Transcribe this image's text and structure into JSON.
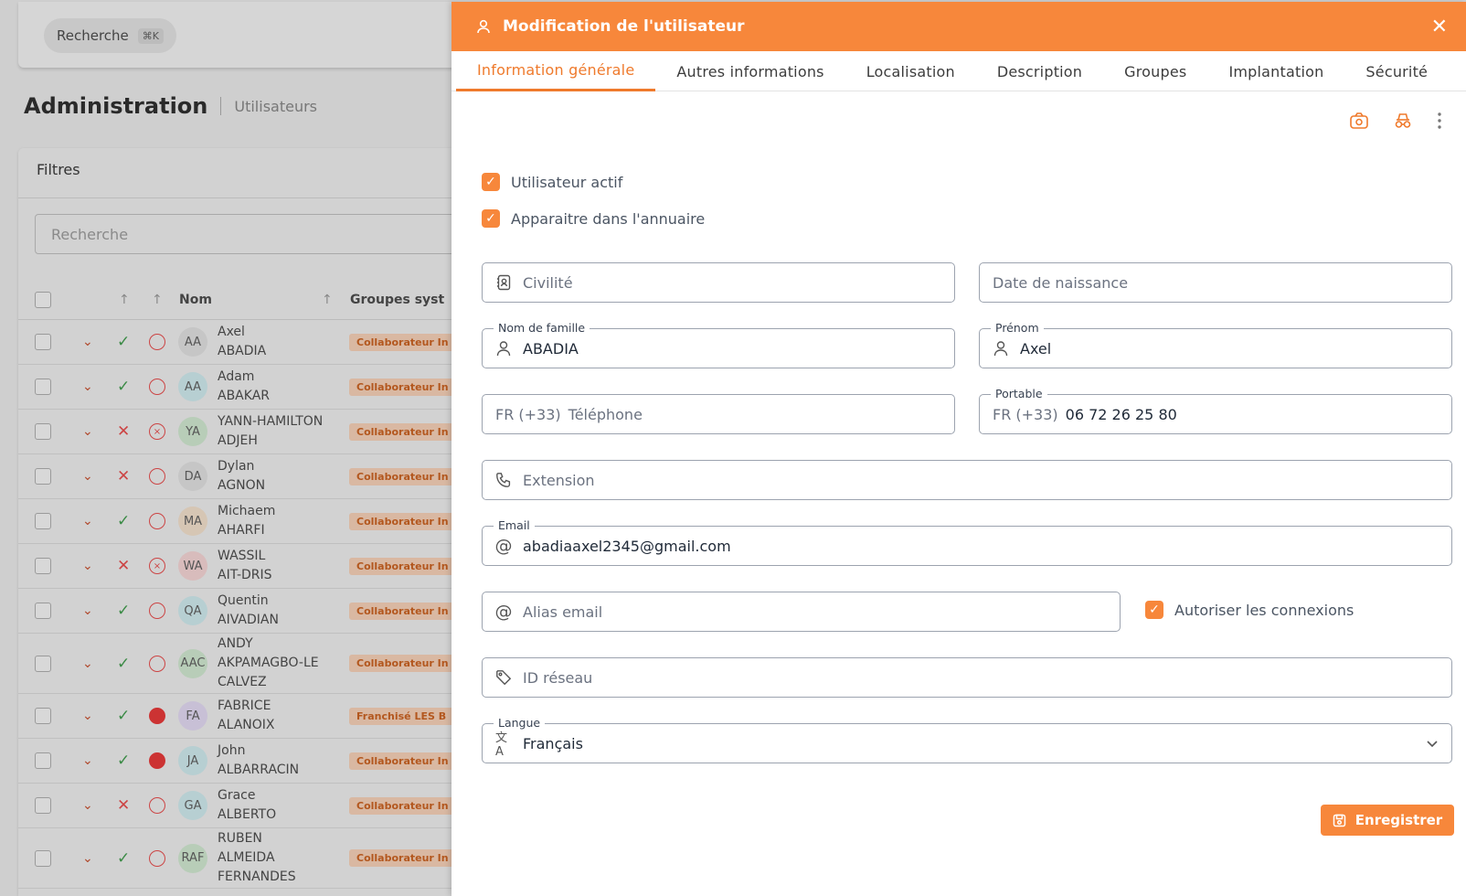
{
  "background": {
    "search_label": "Recherche",
    "search_shortcut": "⌘K",
    "page_title": "Administration",
    "page_subtitle": "Utilisateurs",
    "filters_title": "Filtres",
    "filters_search_placeholder": "Recherche",
    "columns": {
      "name": "Nom",
      "groups": "Groupes syst"
    },
    "users": [
      {
        "initials": "AA",
        "first": "Axel",
        "last": "ABADIA",
        "active": true,
        "ring": "empty",
        "tag": "Collaborateur In",
        "avatar_bg": "#c6c6c6"
      },
      {
        "initials": "AA",
        "first": "Adam",
        "last": "ABAKAR",
        "active": true,
        "ring": "empty",
        "tag": "Collaborateur In",
        "avatar_bg": "#b7cfd2"
      },
      {
        "initials": "YA",
        "first": "YANN-HAMILTON",
        "last": "ADJEH",
        "active": false,
        "ring": "x",
        "tag": "Collaborateur In",
        "avatar_bg": "#b8cdb8"
      },
      {
        "initials": "DA",
        "first": "Dylan",
        "last": "AGNON",
        "active": false,
        "ring": "empty",
        "tag": "Collaborateur In",
        "avatar_bg": "#c6c6c6"
      },
      {
        "initials": "MA",
        "first": "Michaem",
        "last": "AHARFI",
        "active": true,
        "ring": "empty",
        "tag": "Collaborateur In",
        "avatar_bg": "#d6c6b4"
      },
      {
        "initials": "WA",
        "first": "WASSIL",
        "last": "AIT-DRIS",
        "active": false,
        "ring": "x",
        "tag": "Collaborateur In",
        "avatar_bg": "#d8bcbc"
      },
      {
        "initials": "QA",
        "first": "Quentin",
        "last": "AIVADIAN",
        "active": true,
        "ring": "empty",
        "tag": "Collaborateur In",
        "avatar_bg": "#b7cfd2"
      },
      {
        "initials": "AAC",
        "first": "ANDY",
        "last": "AKPAMAGBO-LE",
        "extra": "CALVEZ",
        "active": true,
        "ring": "empty",
        "tag": "Collaborateur In",
        "avatar_bg": "#b8cdb8"
      },
      {
        "initials": "FA",
        "first": "FABRICE",
        "last": "ALANOIX",
        "active": true,
        "ring": "full",
        "tag": "Franchisé LES B",
        "avatar_bg": "#c8c0d6"
      },
      {
        "initials": "JA",
        "first": "John",
        "last": "ALBARRACIN",
        "active": true,
        "ring": "full",
        "tag": "Collaborateur In",
        "avatar_bg": "#b7cfd2"
      },
      {
        "initials": "GA",
        "first": "Grace",
        "last": "ALBERTO",
        "active": false,
        "ring": "empty",
        "tag": "Collaborateur In",
        "avatar_bg": "#b7cfd2"
      },
      {
        "initials": "RAF",
        "first": "RUBEN",
        "last": "ALMEIDA",
        "extra": "FERNANDES",
        "active": true,
        "ring": "empty",
        "tag": "Collaborateur In",
        "avatar_bg": "#b8cdb8"
      }
    ]
  },
  "drawer": {
    "title": "Modification de l'utilisateur",
    "tabs": [
      "Information générale",
      "Autres informations",
      "Localisation",
      "Description",
      "Groupes",
      "Implantation",
      "Sécurité"
    ],
    "checkbox_active": "Utilisateur actif",
    "checkbox_directory": "Apparaitre dans l'annuaire",
    "fields": {
      "civility_placeholder": "Civilité",
      "birthdate_placeholder": "Date de naissance",
      "lastname_label": "Nom de famille",
      "lastname_value": "ABADIA",
      "firstname_label": "Prénom",
      "firstname_value": "Axel",
      "phone_prefix": "FR (+33)",
      "phone_placeholder": "Téléphone",
      "mobile_label": "Portable",
      "mobile_prefix": "FR (+33)",
      "mobile_value": "06 72 26 25 80",
      "extension_placeholder": "Extension",
      "email_label": "Email",
      "email_value": "abadiaaxel2345@gmail.com",
      "alias_placeholder": "Alias email",
      "allow_connections": "Autoriser les connexions",
      "network_id_placeholder": "ID réseau",
      "language_label": "Langue",
      "language_value": "Français"
    },
    "save_label": "Enregistrer"
  },
  "colors": {
    "accent": "#f7873b",
    "accent_text": "#ef7a2c"
  }
}
